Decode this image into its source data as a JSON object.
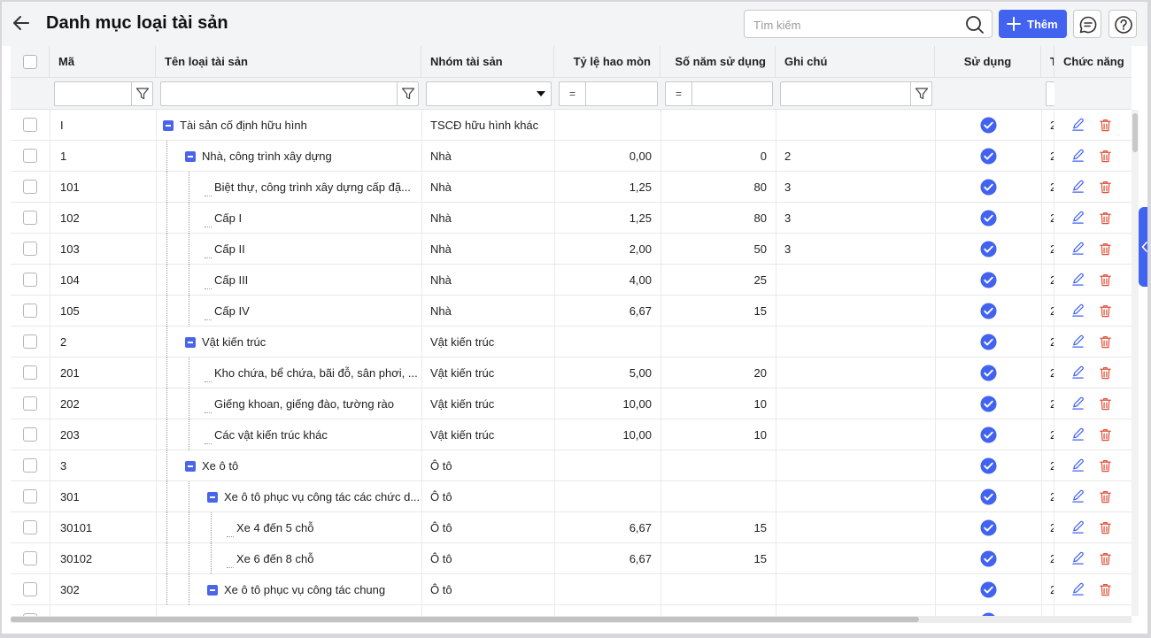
{
  "header": {
    "title": "Danh mục loại tài sản",
    "search_placeholder": "Tìm kiếm",
    "add_label": "Thêm"
  },
  "columns": {
    "code": "Mã",
    "name": "Tên loại tài sản",
    "group": "Nhóm tài sản",
    "rate": "Tỷ lệ hao mòn",
    "years": "Số năm sử dụng",
    "note": "Ghi chú",
    "used": "Sử dụng",
    "extra": "T",
    "actions": "Chức năng"
  },
  "filters": {
    "rate_op": "=",
    "years_op": "="
  },
  "colors": {
    "accent": "#4262f0",
    "delete": "#e0523a"
  },
  "rows": [
    {
      "code": "I",
      "name": "Tài sản cố định hữu hình",
      "group": "TSCĐ hữu hình khác",
      "rate": "",
      "years": "",
      "note": "",
      "extra": "2"
    },
    {
      "code": "1",
      "name": "Nhà, công trình xây dựng",
      "group": "Nhà",
      "rate": "0,00",
      "years": "0",
      "note": "2",
      "extra": "2"
    },
    {
      "code": "101",
      "name": "Biệt thự, công trình xây dựng cấp đặ...",
      "group": "Nhà",
      "rate": "1,25",
      "years": "80",
      "note": "3",
      "extra": "2"
    },
    {
      "code": "102",
      "name": "Cấp I",
      "group": "Nhà",
      "rate": "1,25",
      "years": "80",
      "note": "3",
      "extra": "2"
    },
    {
      "code": "103",
      "name": "Cấp II",
      "group": "Nhà",
      "rate": "2,00",
      "years": "50",
      "note": "3",
      "extra": "2"
    },
    {
      "code": "104",
      "name": "Cấp III",
      "group": "Nhà",
      "rate": "4,00",
      "years": "25",
      "note": "",
      "extra": "2"
    },
    {
      "code": "105",
      "name": "Cấp IV",
      "group": "Nhà",
      "rate": "6,67",
      "years": "15",
      "note": "",
      "extra": "2"
    },
    {
      "code": "2",
      "name": "Vật kiến trúc",
      "group": "Vật kiến trúc",
      "rate": "",
      "years": "",
      "note": "",
      "extra": "2"
    },
    {
      "code": "201",
      "name": "Kho chứa, bể chứa, bãi đỗ, sân phơi, ...",
      "group": "Vật kiến trúc",
      "rate": "5,00",
      "years": "20",
      "note": "",
      "extra": "2"
    },
    {
      "code": "202",
      "name": "Giếng khoan, giếng đào, tường rào",
      "group": "Vật kiến trúc",
      "rate": "10,00",
      "years": "10",
      "note": "",
      "extra": "2"
    },
    {
      "code": "203",
      "name": "Các vật kiến trúc khác",
      "group": "Vật kiến trúc",
      "rate": "10,00",
      "years": "10",
      "note": "",
      "extra": "2"
    },
    {
      "code": "3",
      "name": "Xe ô tô",
      "group": "Ô tô",
      "rate": "",
      "years": "",
      "note": "",
      "extra": "2"
    },
    {
      "code": "301",
      "name": "Xe ô tô phục vụ công tác các chức d...",
      "group": "Ô tô",
      "rate": "",
      "years": "",
      "note": "",
      "extra": "2"
    },
    {
      "code": "30101",
      "name": "Xe 4 đến 5 chỗ",
      "group": "Ô tô",
      "rate": "6,67",
      "years": "15",
      "note": "",
      "extra": "2"
    },
    {
      "code": "30102",
      "name": "Xe 6 đến 8 chỗ",
      "group": "Ô tô",
      "rate": "6,67",
      "years": "15",
      "note": "",
      "extra": "2"
    },
    {
      "code": "302",
      "name": "Xe ô tô phục vụ công tác chung",
      "group": "Ô tô",
      "rate": "",
      "years": "",
      "note": "",
      "extra": "2"
    }
  ]
}
